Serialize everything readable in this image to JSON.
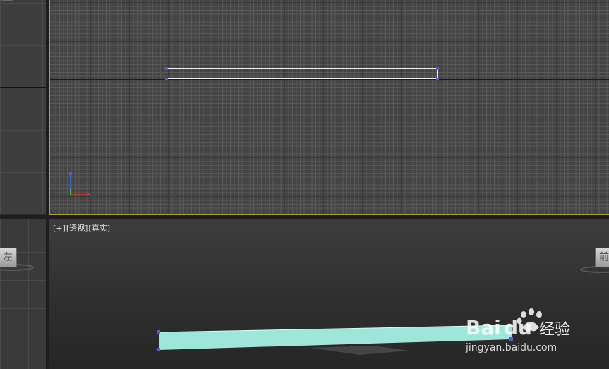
{
  "viewports": {
    "top_left": {
      "name": "side-viewport"
    },
    "top": {
      "name": "top-viewport",
      "active": true
    },
    "bottom_left": {
      "viewcube_face": "左"
    },
    "perspective": {
      "label_parts": [
        "[+]",
        "[透视]",
        "[真实]"
      ],
      "viewcube_face": "前"
    }
  },
  "colors": {
    "active_border": "#b39a3d",
    "selection": "#f2f2f2",
    "vertex": "#5a5ad8",
    "plane_object": "#9de6d9"
  },
  "watermark": {
    "brand_text": "Bai",
    "brand_text_2": "du",
    "brand_cn": "经验",
    "url": "jingyan.baidu.com"
  }
}
